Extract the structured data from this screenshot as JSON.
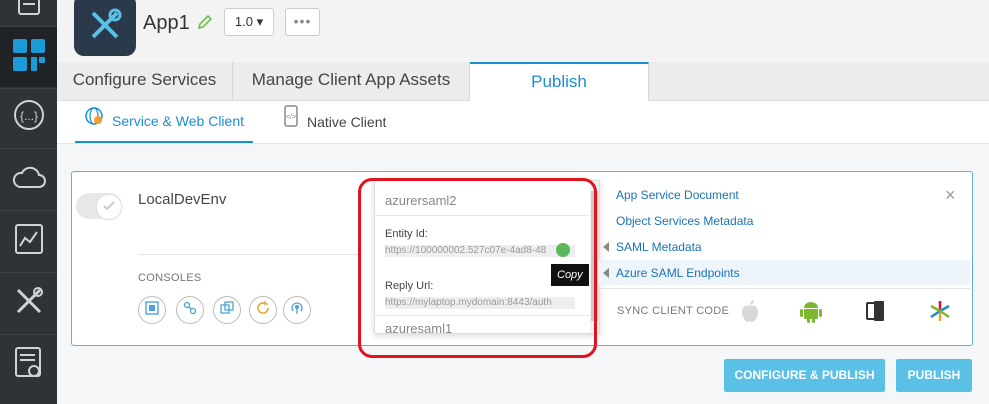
{
  "app": {
    "name": "App1",
    "version": "1.0",
    "more": "•••"
  },
  "tabs": [
    {
      "label": "Configure Services"
    },
    {
      "label": "Manage Client App Assets"
    },
    {
      "label": "Publish"
    }
  ],
  "subtabs": [
    {
      "label": "Service & Web Client"
    },
    {
      "label": "Native Client"
    }
  ],
  "environment": {
    "name": "LocalDevEnv",
    "consoles_label": "CONSOLES"
  },
  "dropdown": {
    "item1_title": "azurersaml2",
    "entity_label": "Entity Id:",
    "entity_value": "https://100000002.527c07e-4ad8-48",
    "reply_label": "Reply Url:",
    "reply_value": "https://mylaptop.mydomain:8443/auth",
    "item2_title": "azuresaml1",
    "copy_tooltip": "Copy"
  },
  "menu": {
    "items": [
      {
        "label": "App Service Document"
      },
      {
        "label": "Object Services Metadata"
      },
      {
        "label": "SAML Metadata"
      },
      {
        "label": "Azure SAML Endpoints"
      }
    ],
    "close": "×",
    "sync_label": "SYNC CLIENT CODE"
  },
  "buttons": {
    "configure_publish": "CONFIGURE & PUBLISH",
    "publish": "PUBLISH"
  },
  "colors": {
    "accent": "#1a8fd0",
    "highlight": "#e0141e",
    "button": "#5bc0e6"
  }
}
